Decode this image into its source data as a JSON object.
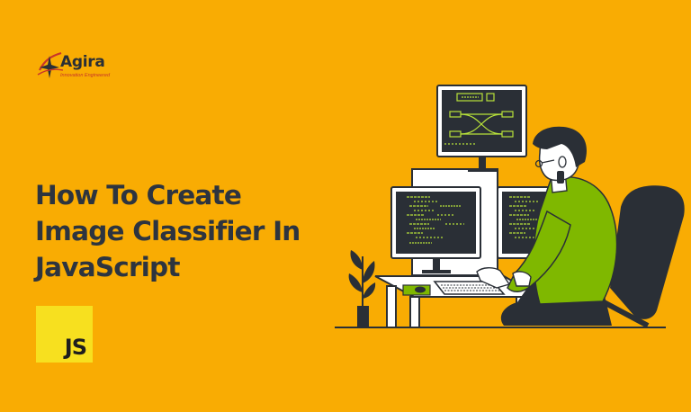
{
  "brand": {
    "name": "Agira",
    "tagline": "Innovation Engineered",
    "logo_icon": "agira-star-swoosh-logo"
  },
  "headline": {
    "line1": "How To Create",
    "line2": "Image Classifier In",
    "line3": "JavaScript"
  },
  "badge": {
    "label": "JS",
    "color": "#F7E01F"
  },
  "colors": {
    "background": "#F9AC03",
    "headline_text": "#2D343F",
    "screen_text": "#B8E23A",
    "shirt": "#7FB800",
    "accent_red": "#C8352A"
  },
  "illustration": {
    "icon": "programmer-at-multi-monitor-desk-illustration"
  }
}
